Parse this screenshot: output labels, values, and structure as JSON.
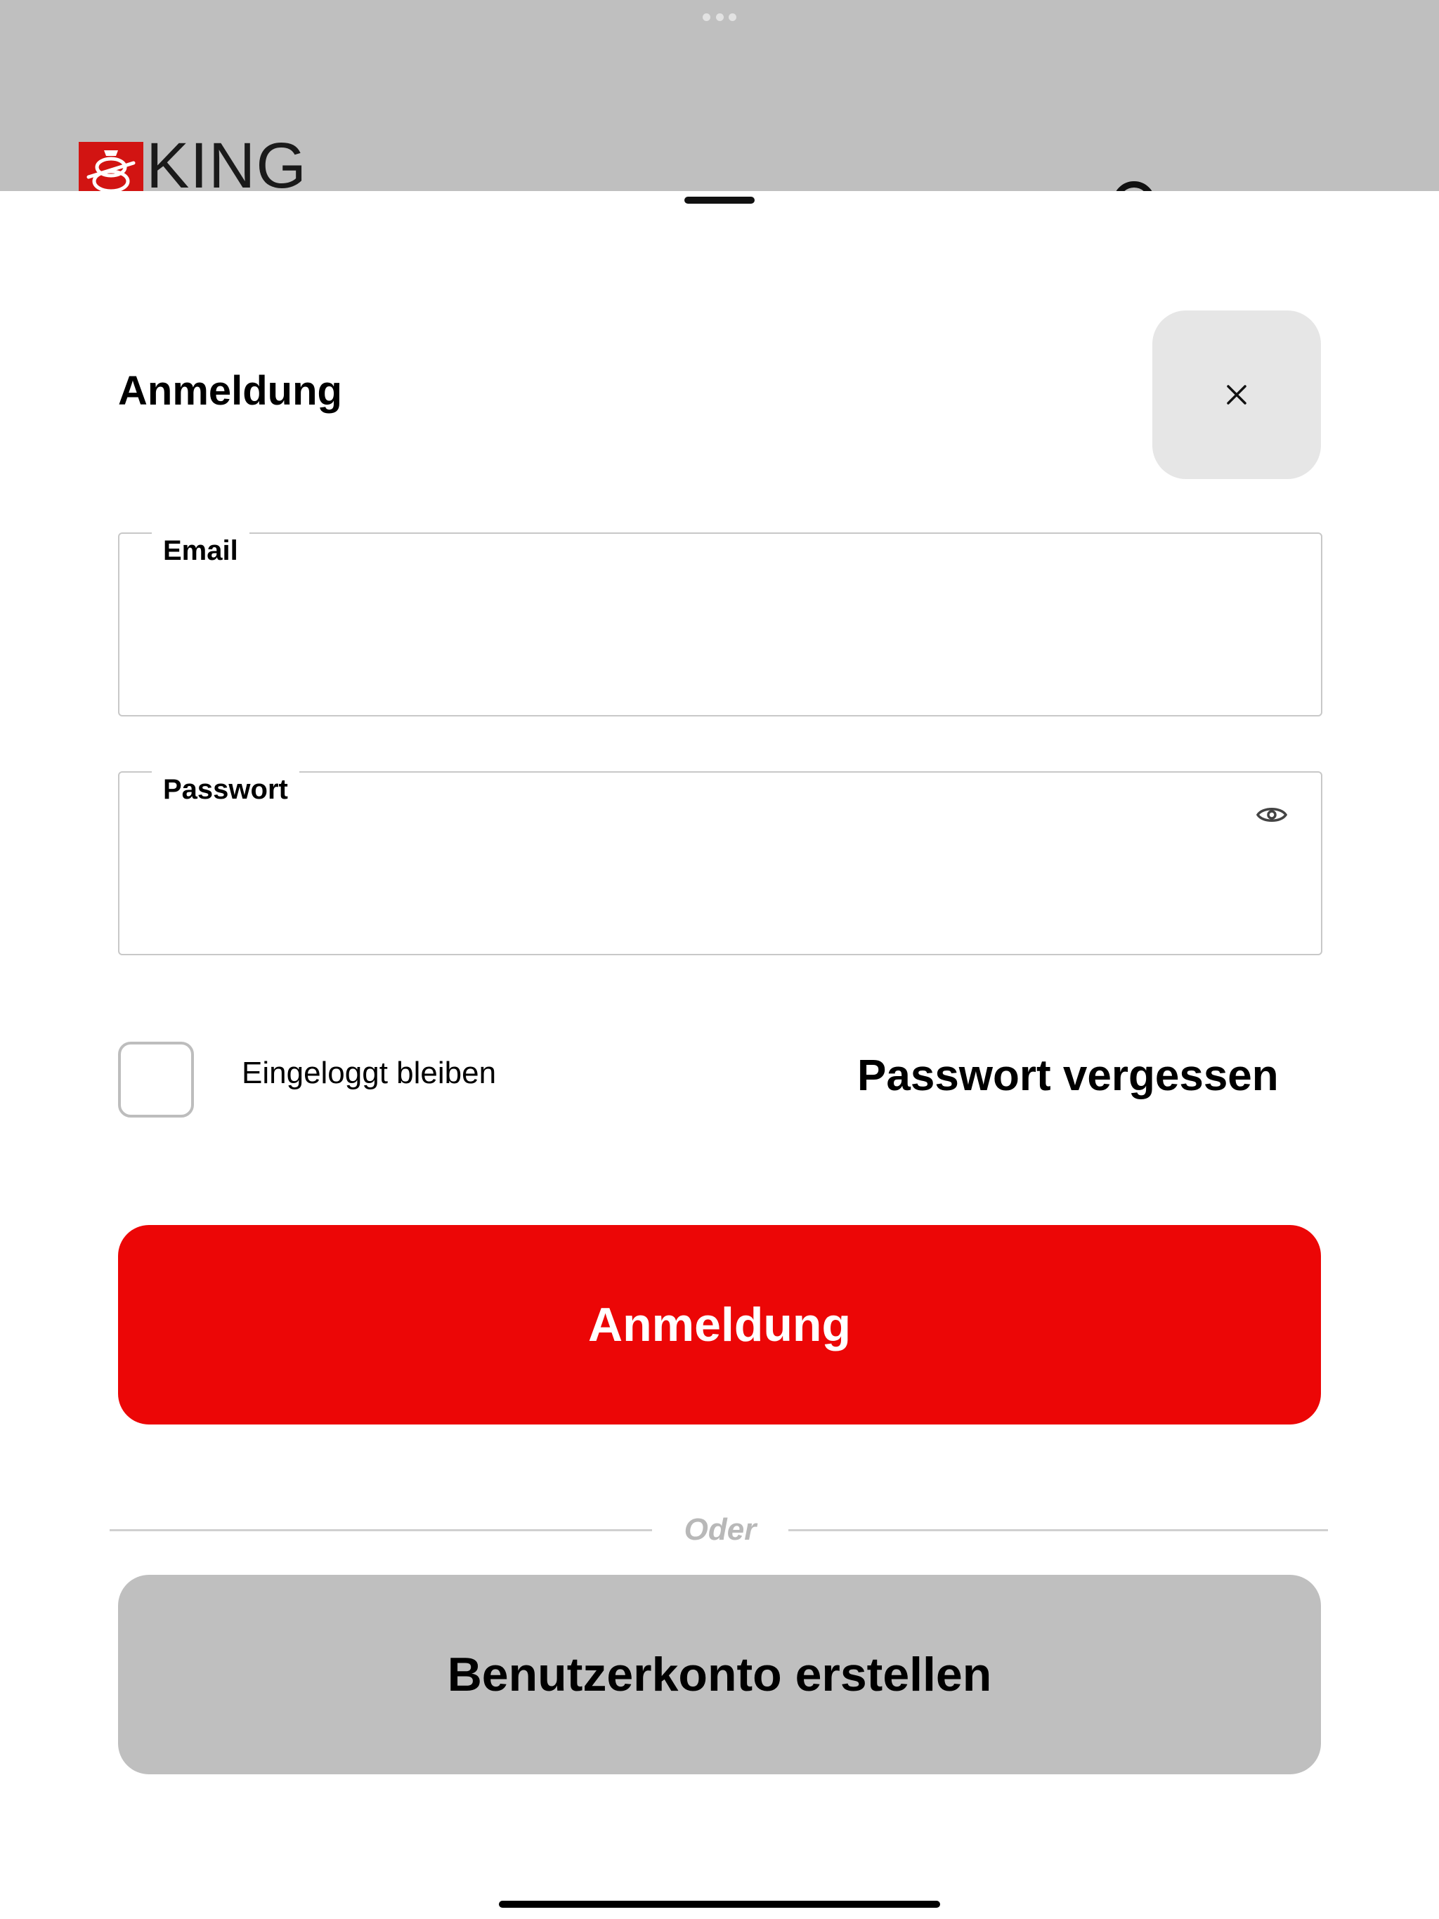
{
  "background_app": {
    "brand": {
      "name": "KING",
      "color": "#d21412"
    },
    "icons": {
      "multitask": "more-dots-icon",
      "account": "user-icon"
    }
  },
  "sheet": {
    "title": "Anmeldung",
    "close_icon": "close-icon"
  },
  "form": {
    "email": {
      "label": "Email",
      "value": "",
      "placeholder": ""
    },
    "password": {
      "label": "Passwort",
      "value": "",
      "placeholder": "",
      "toggle_icon": "eye-icon"
    },
    "remember_me": {
      "label": "Eingeloggt bleiben",
      "checked": false
    },
    "forgot_password_label": "Passwort vergessen",
    "login_button_label": "Anmeldung",
    "divider_text": "Oder",
    "register_button_label": "Benutzerkonto erstellen"
  },
  "colors": {
    "primary": "#ec0606",
    "secondary_button": "#bfbfbf",
    "close_button": "#e6e6e6",
    "divider_text": "#b8b8b8"
  }
}
